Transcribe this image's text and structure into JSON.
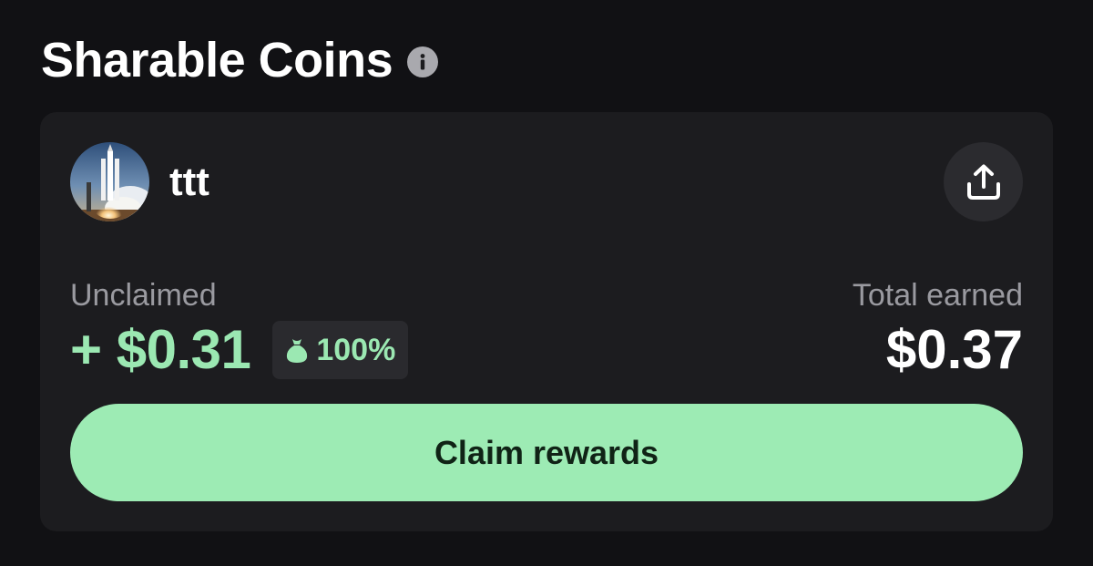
{
  "header": {
    "title": "Sharable Coins",
    "info_icon": "info-icon"
  },
  "coin": {
    "name": "ttt",
    "avatar_icon": "rocket-launch-avatar",
    "share_icon": "share-upload-icon"
  },
  "stats": {
    "unclaimed_label": "Unclaimed",
    "unclaimed_amount": "+ $0.31",
    "share_percent": "100%",
    "share_percent_icon": "money-bag-icon",
    "total_label": "Total earned",
    "total_amount": "$0.37"
  },
  "actions": {
    "claim_label": "Claim rewards"
  },
  "colors": {
    "background": "#111114",
    "card": "#1c1c1f",
    "accent_green": "#9be8b2",
    "button_green": "#9debb4",
    "muted_text": "#9a9aa0"
  }
}
